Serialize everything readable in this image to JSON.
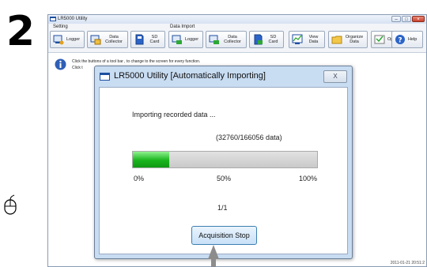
{
  "step_number": "2",
  "app_window": {
    "title": "LR5000 Utility",
    "toolbar": {
      "setting_label": "Setting",
      "data_import_label": "Data Import",
      "buttons": [
        {
          "label": "Logger"
        },
        {
          "label": "Data Collector"
        },
        {
          "label": "SD Card"
        },
        {
          "label": "Logger"
        },
        {
          "label": "Data Collector"
        },
        {
          "label": "SD Card"
        },
        {
          "label": "View Data"
        },
        {
          "label": "Organize Data"
        },
        {
          "label": "Option"
        },
        {
          "label": "Help"
        }
      ]
    },
    "info_line_1": "Click the buttons of a tool bar , to change to the screen for every function.",
    "info_line_2": "Click t",
    "timestamp": "2011-01-21 20:51:2"
  },
  "dialog": {
    "title": "LR5000 Utility [Automatically Importing]",
    "close_label": "X",
    "status_text": "Importing recorded data ...",
    "count_text": "(32760/166056 data)",
    "progress_fraction": 0.197,
    "progress_color": "#19b41d",
    "scale_labels": [
      "0%",
      "50%",
      "100%"
    ],
    "page_text": "1/1",
    "stop_button_label": "Acquisition Stop"
  },
  "colors": {
    "dialog_frame": "#c8dcf2",
    "button_border": "#3c7fb1",
    "info_icon": "#2f5fb6"
  },
  "icons": {
    "step": "mouse-icon",
    "window": "window-icon",
    "info": "info-icon",
    "pointer": "pointer-arrow-icon"
  }
}
